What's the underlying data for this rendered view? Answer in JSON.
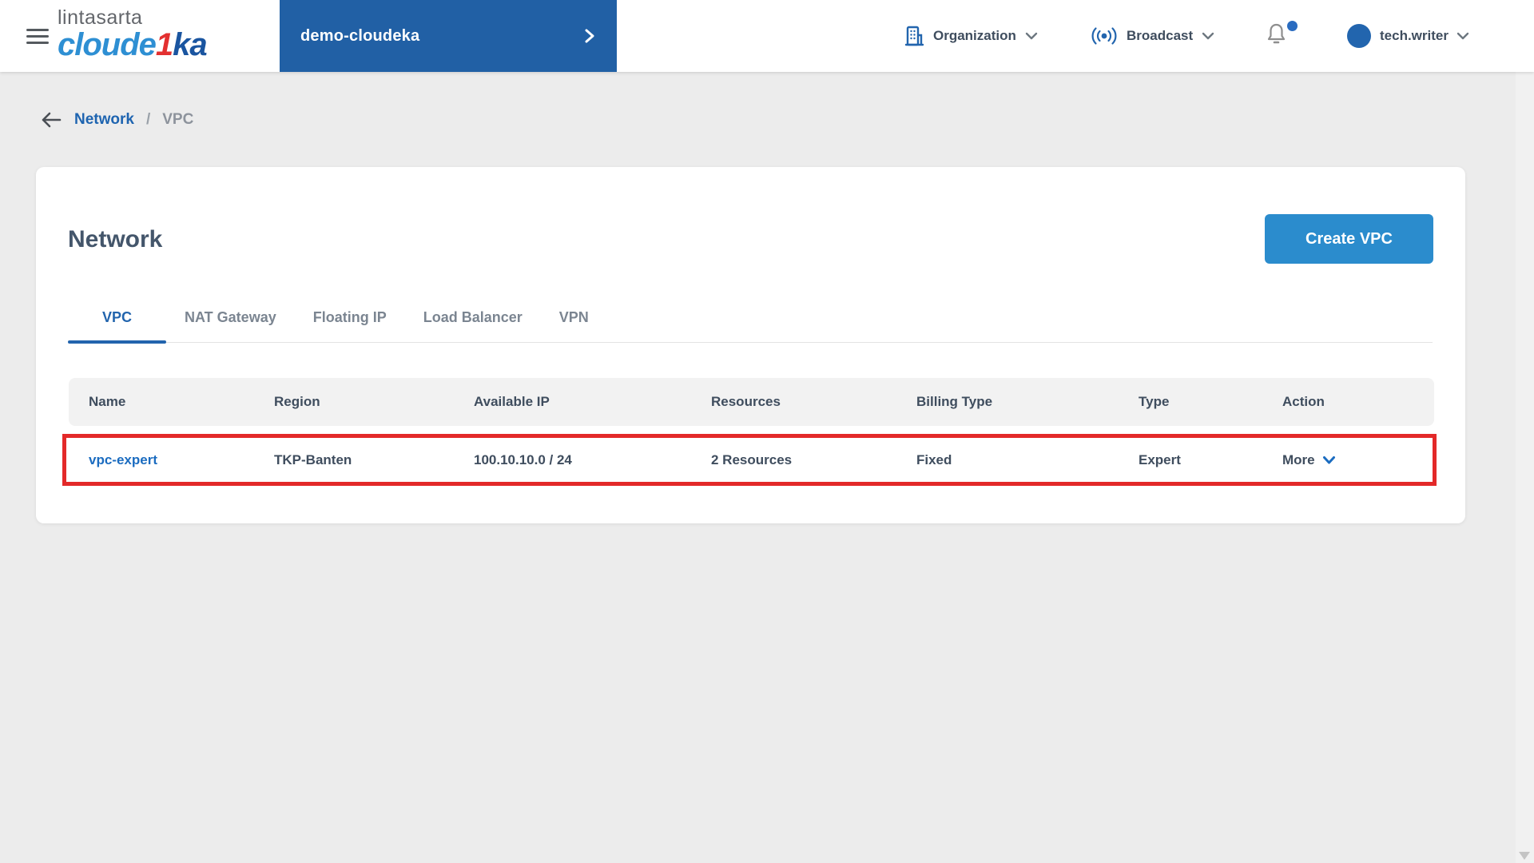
{
  "brand": {
    "line1": "lintasarta",
    "logo_part1": "cloude",
    "logo_part2": "1",
    "logo_part3": "ka"
  },
  "header": {
    "project_name": "demo-cloudeka",
    "organization_label": "Organization",
    "broadcast_label": "Broadcast",
    "username": "tech.writer"
  },
  "breadcrumb": {
    "section": "Network",
    "separator": "/",
    "current": "VPC"
  },
  "page": {
    "title": "Network",
    "create_button_label": "Create VPC",
    "tabs": [
      {
        "label": "VPC",
        "active": true
      },
      {
        "label": "NAT Gateway",
        "active": false
      },
      {
        "label": "Floating IP",
        "active": false
      },
      {
        "label": "Load Balancer",
        "active": false
      },
      {
        "label": "VPN",
        "active": false
      }
    ]
  },
  "table": {
    "columns": [
      "Name",
      "Region",
      "Available IP",
      "Resources",
      "Billing Type",
      "Type",
      "Action"
    ],
    "rows": [
      {
        "name": "vpc-expert",
        "region": "TKP-Banten",
        "available_ip": "100.10.10.0 / 24",
        "resources": "2 Resources",
        "billing_type": "Fixed",
        "type": "Expert",
        "action": "More",
        "highlighted": true
      }
    ]
  },
  "colors": {
    "primary_blue": "#2160a5",
    "accent_blue": "#2264ad",
    "button_blue": "#2b8ccd",
    "link_blue": "#1b6cc0",
    "logo_light_blue": "#2e8fd3",
    "logo_dark_blue": "#1a55a0",
    "logo_red": "#e33030",
    "highlight_red": "#e32929",
    "text_dark": "#3f4d5e",
    "text_gray": "#7b8591",
    "page_background": "#ececec",
    "table_header_bg": "#f2f2f2"
  }
}
